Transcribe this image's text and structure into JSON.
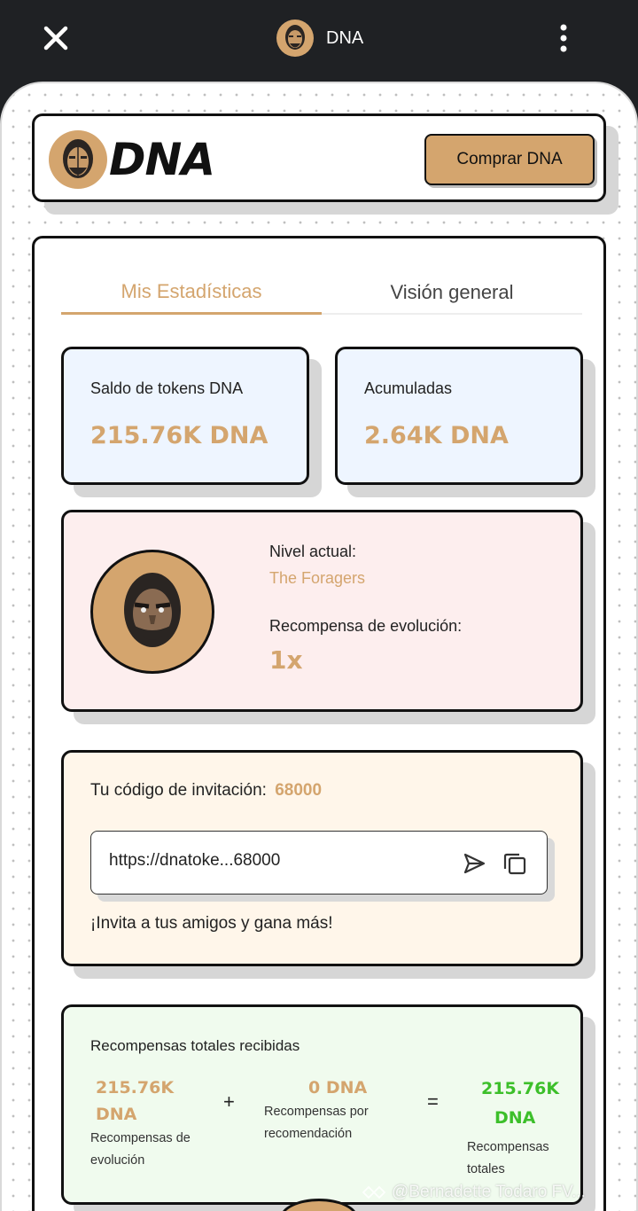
{
  "topbar": {
    "title": "DNA",
    "close_icon": "close-icon",
    "menu_icon": "more-vertical-icon"
  },
  "header": {
    "brand_text": "DNA",
    "buy_button": "Comprar DNA"
  },
  "tabs": [
    {
      "label": "Mis Estadísticas",
      "active": true
    },
    {
      "label": "Visión general",
      "active": false
    }
  ],
  "stats": {
    "balance_label": "Saldo de tokens DNA",
    "balance_value": "215.76K DNA",
    "accumulated_label": "Acumuladas",
    "accumulated_value": "2.64K DNA"
  },
  "level": {
    "current_label": "Nivel actual:",
    "current_name": "The Foragers",
    "reward_label": "Recompensa de evolución:",
    "reward_value": "1x"
  },
  "invite": {
    "title": "Tu código de invitación:",
    "code": "68000",
    "link": "https://dnatoke...68000",
    "note": "¡Invita a tus amigos y gana más!"
  },
  "totals": {
    "title": "Recompensas totales recibidas",
    "evolution_value": "215.76K DNA",
    "evolution_label_1": "Recompensas de",
    "evolution_label_2": "evolución",
    "plus": "+",
    "referral_value": "0 DNA",
    "referral_label_1": "Recompensas por",
    "referral_label_2": "recomendación",
    "equals": "=",
    "total_value_1": "215.76K",
    "total_value_2": "DNA",
    "total_label_1": "Recompensas",
    "total_label_2": "totales"
  },
  "watermark": "@Bernadette Todaro FV...",
  "colors": {
    "accent": "#d4a56e",
    "green": "#3cbf2a",
    "dark_bar": "#1f2124"
  }
}
